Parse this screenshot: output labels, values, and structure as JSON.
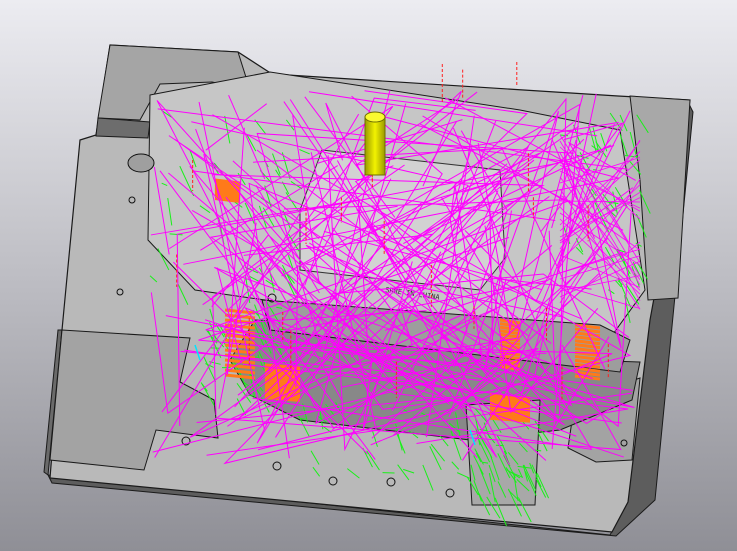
{
  "viewport": {
    "background_top": "#ececf1",
    "background_bottom": "#8f8f96",
    "colors": {
      "mold_light": "#c8c8c8",
      "mold_mid": "#a9a9a9",
      "mold_dark": "#6e6e6e",
      "edge": "#1a1a1a",
      "toolpath_magenta": "#ff00ff",
      "toolpath_green": "#19f019",
      "toolpath_orange": "#ff7a1a",
      "toolpath_red": "#ff2020",
      "cutter_yellow": "#e6e600",
      "toolpath_cyan": "#00e5ff"
    },
    "icons": [
      "cutter-tool-icon"
    ]
  },
  "part": {
    "engraved_text": "SRRE IN CHINA"
  }
}
